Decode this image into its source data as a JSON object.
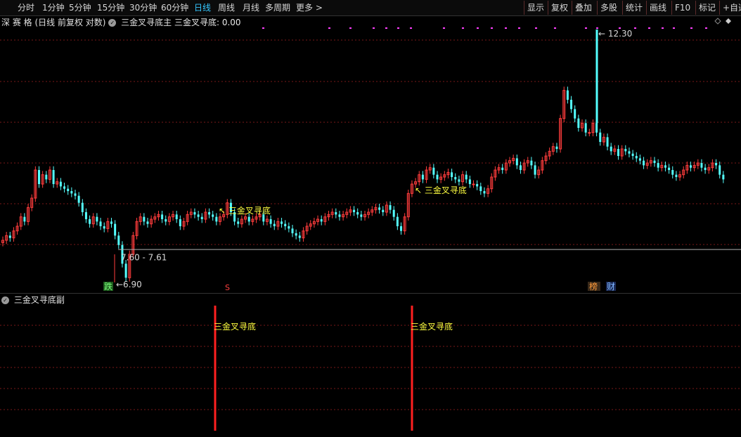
{
  "toolbar": {
    "periods": [
      "分时",
      "1分钟",
      "5分钟",
      "15分钟",
      "30分钟",
      "60分钟",
      "日线",
      "周线",
      "月线",
      "多周期",
      "更多"
    ],
    "active_period": "日线",
    "right_buttons": [
      "显示",
      "复权",
      "叠加",
      "多股",
      "统计",
      "画线",
      "F10",
      "标记",
      "+自选"
    ]
  },
  "main_header": {
    "stock_name": "深 赛 格",
    "period_info": "(日线 前复权 对数)",
    "indicator_name": "三金叉寻底主",
    "indicator_value": "三金叉寻底: 0.00"
  },
  "annotations": {
    "high_label": "12.30",
    "low_label": "6.90",
    "range_label": "7.60 - 7.61",
    "signal_label_1": "三金叉寻底",
    "signal_label_2": "三金叉寻底",
    "badge_die": "跌",
    "badge_s": "S",
    "badge_bang": "榜",
    "badge_cai": "财"
  },
  "sub_header": {
    "indicator_name": "三金叉寻底副"
  },
  "sub_signals": [
    "三金叉寻底",
    "三金叉寻底"
  ],
  "colors": {
    "up": "#ff3c3c",
    "down": "#54ffff",
    "active_tab": "#35c7ff",
    "signal_text": "#ffff40",
    "marker": "#ff40ff",
    "grid": "#7a1818"
  },
  "chart_data": {
    "type": "candlestick",
    "price_range": [
      6.9,
      12.3
    ],
    "series": [
      {
        "name": "price",
        "close": [
          7.8,
          7.9,
          7.85,
          8.0,
          8.1,
          8.3,
          8.2,
          8.5,
          8.7,
          9.3,
          9.0,
          9.2,
          9.1,
          9.3,
          9.0,
          9.05,
          8.95,
          8.9,
          8.85,
          8.8,
          8.75,
          8.6,
          8.4,
          8.25,
          8.15,
          8.3,
          8.2,
          8.1,
          8.05,
          8.2,
          8.15,
          7.9,
          7.7,
          7.3,
          7.0,
          7.5,
          7.9,
          8.2,
          8.3,
          8.2,
          8.15,
          8.25,
          8.3,
          8.35,
          8.25,
          8.2,
          8.3,
          8.35,
          8.25,
          8.1,
          8.2,
          8.35,
          8.4,
          8.35,
          8.3,
          8.25,
          8.4,
          8.35,
          8.3,
          8.2,
          8.3,
          8.35,
          8.6,
          8.4,
          8.2,
          8.15,
          8.25,
          8.3,
          8.2,
          8.25,
          8.3,
          8.35,
          8.2,
          8.25,
          8.15,
          8.1,
          8.2,
          8.15,
          8.1,
          8.05,
          7.95,
          7.9,
          7.85,
          8.0,
          8.1,
          8.15,
          8.2,
          8.25,
          8.2,
          8.3,
          8.35,
          8.4,
          8.35,
          8.3,
          8.35,
          8.4,
          8.45,
          8.4,
          8.35,
          8.3,
          8.35,
          8.4,
          8.45,
          8.5,
          8.45,
          8.4,
          8.55,
          8.45,
          8.3,
          8.1,
          8.0,
          8.3,
          8.8,
          9.0,
          9.05,
          9.2,
          9.1,
          9.3,
          9.35,
          9.2,
          9.1,
          9.15,
          9.2,
          9.25,
          9.15,
          9.1,
          9.05,
          9.2,
          9.1,
          9.0,
          9.0,
          8.95,
          8.85,
          8.8,
          8.9,
          9.15,
          9.3,
          9.35,
          9.3,
          9.45,
          9.5,
          9.55,
          9.4,
          9.3,
          9.45,
          9.5,
          9.4,
          9.2,
          9.3,
          9.5,
          9.6,
          9.7,
          9.8,
          9.75,
          10.4,
          11.0,
          10.8,
          10.6,
          10.4,
          10.2,
          10.3,
          10.1,
          10.1,
          10.3,
          10.1,
          9.9,
          10.0,
          9.8,
          9.7,
          9.75,
          9.6,
          9.75,
          9.7,
          9.65,
          9.6,
          9.55,
          9.5,
          9.4,
          9.45,
          9.5,
          9.45,
          9.35,
          9.4,
          9.35,
          9.3,
          9.2,
          9.15,
          9.2,
          9.3,
          9.4,
          9.35,
          9.4,
          9.45,
          9.35,
          9.3,
          9.35,
          9.45,
          9.4,
          9.2,
          9.1
        ]
      }
    ],
    "signals": [
      {
        "label": "三金叉寻底",
        "price": 8.1
      },
      {
        "label": "三金叉寻底",
        "price": 8.5
      }
    ]
  }
}
